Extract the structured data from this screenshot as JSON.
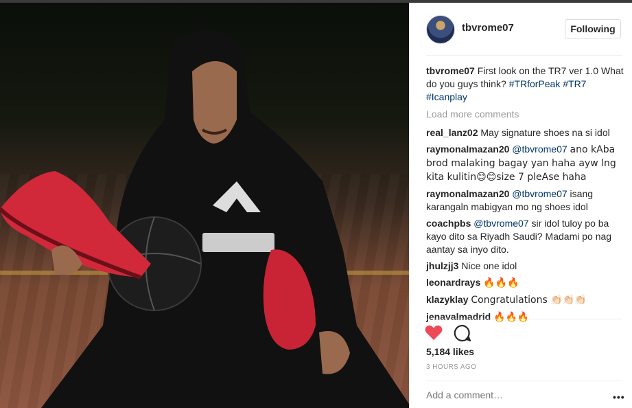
{
  "photo": {
    "alt_brand": "PEAK"
  },
  "post": {
    "username": "tbvrome07",
    "follow_label": "Following",
    "caption": {
      "user": "tbvrome07",
      "text": "First look on the TR7 ver 1.0 What do you guys think?",
      "tags": [
        "#TRforPeak",
        "#TR7",
        "#Icanplay"
      ]
    },
    "load_more": "Load more comments",
    "comments": [
      {
        "user": "real_lanz02",
        "text": "May signature shoes na si idol"
      },
      {
        "user": "raymonalmazan20",
        "mention": "@tbvrome07",
        "text": "ano kAba brod malaking bagay yan haha ayw lng kita kulitin😊😊size 7 pleAse haha"
      },
      {
        "user": "raymonalmazan20",
        "mention": "@tbvrome07",
        "text": "isang karangaln mabigyan mo ng shoes idol"
      },
      {
        "user": "coachpbs",
        "mention": "@tbvrome07",
        "text": "sir idol tuloy po ba kayo dito sa Riyadh Saudi? Madami po nag aantay sa inyo dito."
      },
      {
        "user": "jhulzjj3",
        "text": "Nice one idol"
      },
      {
        "user": "leonardrays",
        "text": "🔥🔥🔥"
      },
      {
        "user": "klazyklay",
        "text": "Congratulations 👏🏻👏🏻👏🏻"
      },
      {
        "user": "jenavalmadrid",
        "text": "🔥🔥🔥"
      }
    ],
    "likes": "5,184 likes",
    "time": "3 HOURS AGO",
    "add_comment_placeholder": "Add a comment…",
    "more_label": "•••"
  },
  "colors": {
    "heart": "#ed4956",
    "link": "#003569",
    "muted": "#999999"
  },
  "icons": {
    "like": "heart-icon",
    "comment": "speech-bubble-icon",
    "more": "more-options-icon"
  }
}
